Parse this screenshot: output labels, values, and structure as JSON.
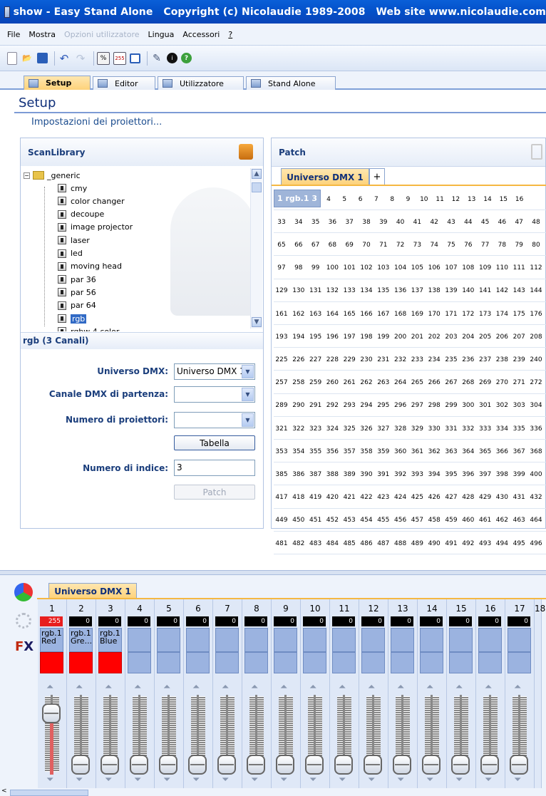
{
  "window": {
    "title": "show - Easy Stand Alone   Copyright (c) Nicolaudie 1989-2008   Web site www.nicolaudie.com"
  },
  "menu": {
    "file": "File",
    "mostra": "Mostra",
    "opzioni": "Opzioni utilizzatore",
    "lingua": "Lingua",
    "accessori": "Accessori",
    "help": "?"
  },
  "toolbar": {
    "btn255": "255"
  },
  "tabs": [
    {
      "label": "Setup"
    },
    {
      "label": "Editor"
    },
    {
      "label": "Utilizzatore"
    },
    {
      "label": "Stand Alone"
    }
  ],
  "page": {
    "title": "Setup",
    "subtitle": "Impostazioni dei proiettori..."
  },
  "library": {
    "title": "ScanLibrary",
    "root": "_generic",
    "items": [
      "cmy",
      "color changer",
      "decoupe",
      "image projector",
      "laser",
      "led",
      "moving head",
      "par 36",
      "par 56",
      "par 64",
      "rgb",
      "rgbw 4 color"
    ],
    "selected": "rgb",
    "detail_title": "rgb (3 Canali)"
  },
  "form": {
    "universe_label": "Universo DMX:",
    "universe_value": "Universo DMX 1",
    "start_label": "Canale DMX di partenza:",
    "start_value": "",
    "count_label": "Numero di proiettori:",
    "count_value": "",
    "table_button": "Tabella",
    "index_label": "Numero di indice:",
    "index_value": "3",
    "patch_button": "Patch"
  },
  "patch": {
    "title": "Patch",
    "tab_label": "Universo DMX 1",
    "plus": "+",
    "patched_label": "1 rgb.1 3"
  },
  "mixer": {
    "tab_label": "Universo DMX 1",
    "channels": [
      {
        "num": "1",
        "value": "255",
        "label": "rgb.1 Red",
        "color": "#ff0000",
        "level": 1.0
      },
      {
        "num": "2",
        "value": "0",
        "label": "rgb.1 Gre...",
        "color": "#ff0000",
        "level": 0
      },
      {
        "num": "3",
        "value": "0",
        "label": "rgb.1 Blue",
        "color": "#ff0000",
        "level": 0
      },
      {
        "num": "4",
        "value": "0",
        "label": "",
        "color": "",
        "level": 0
      },
      {
        "num": "5",
        "value": "0",
        "label": "",
        "color": "",
        "level": 0
      },
      {
        "num": "6",
        "value": "0",
        "label": "",
        "color": "",
        "level": 0
      },
      {
        "num": "7",
        "value": "0",
        "label": "",
        "color": "",
        "level": 0
      },
      {
        "num": "8",
        "value": "0",
        "label": "",
        "color": "",
        "level": 0
      },
      {
        "num": "9",
        "value": "0",
        "label": "",
        "color": "",
        "level": 0
      },
      {
        "num": "10",
        "value": "0",
        "label": "",
        "color": "",
        "level": 0
      },
      {
        "num": "11",
        "value": "0",
        "label": "",
        "color": "",
        "level": 0
      },
      {
        "num": "12",
        "value": "0",
        "label": "",
        "color": "",
        "level": 0
      },
      {
        "num": "13",
        "value": "0",
        "label": "",
        "color": "",
        "level": 0
      },
      {
        "num": "14",
        "value": "0",
        "label": "",
        "color": "",
        "level": 0
      },
      {
        "num": "15",
        "value": "0",
        "label": "",
        "color": "",
        "level": 0
      },
      {
        "num": "16",
        "value": "0",
        "label": "",
        "color": "",
        "level": 0
      },
      {
        "num": "17",
        "value": "0",
        "label": "",
        "color": "",
        "level": 0
      },
      {
        "num": "18",
        "value": "",
        "label": "",
        "color": "",
        "level": 0
      }
    ]
  },
  "colors": {
    "accent": "#f5b842",
    "title_bar": "#0a5fd8",
    "red": "#ff0000"
  }
}
